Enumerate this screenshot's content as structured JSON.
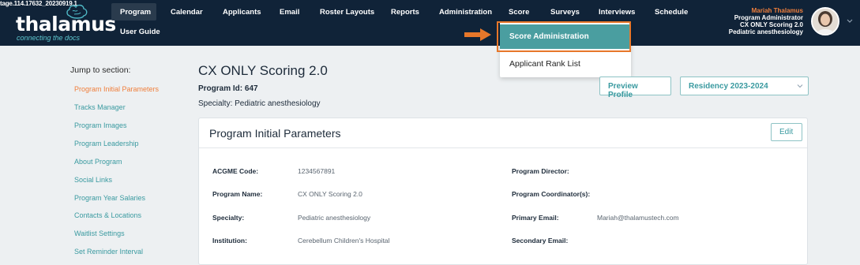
{
  "build_tag": "tage.114.17632_20230919.1",
  "brand": {
    "name": "thalamus",
    "tagline": "connecting the docs"
  },
  "nav": {
    "items": [
      "Program",
      "Calendar",
      "Applicants",
      "Email",
      "Roster Layouts",
      "Reports",
      "Administration",
      "Score",
      "Surveys",
      "Interviews",
      "Schedule"
    ],
    "sub_item": "User Guide"
  },
  "user": {
    "name": "Mariah Thalamus",
    "role": "Program Administrator",
    "program": "CX ONLY Scoring 2.0",
    "specialty": "Pediatric anesthesiology"
  },
  "score_menu": {
    "items": [
      "Score Administration",
      "Applicant Rank List"
    ]
  },
  "sidebar": {
    "title": "Jump to section:",
    "links": [
      "Program Initial Parameters",
      "Tracks Manager",
      "Program Images",
      "Program Leadership",
      "About Program",
      "Social Links",
      "Program Year Salaries",
      "Contacts & Locations",
      "Waitlist Settings",
      "Set Reminder Interval"
    ]
  },
  "header": {
    "title": "CX ONLY Scoring 2.0",
    "program_id": "Program Id: 647",
    "specialty": "Specialty: Pediatric anesthesiology",
    "preview_button": "Preview Profile",
    "season_select": "Residency 2023-2024"
  },
  "card": {
    "title": "Program Initial Parameters",
    "edit_label": "Edit",
    "left_fields": [
      {
        "label": "ACGME Code:",
        "value": "1234567891"
      },
      {
        "label": "Program Name:",
        "value": "CX ONLY Scoring 2.0"
      },
      {
        "label": "Specialty:",
        "value": "Pediatric anesthesiology"
      },
      {
        "label": "Institution:",
        "value": "Cerebellum Children's Hospital"
      }
    ],
    "right_fields": [
      {
        "label": "Program Director:",
        "value": ""
      },
      {
        "label": "Program Coordinator(s):",
        "value": ""
      },
      {
        "label": "Primary Email:",
        "value": "Mariah@thalamustech.com"
      },
      {
        "label": "Secondary Email:",
        "value": ""
      }
    ]
  },
  "colors": {
    "nav_bg": "#102338",
    "accent": "#3a9aa0",
    "orange": "#e7772a",
    "highlight_teal": "#4a9ea0"
  }
}
